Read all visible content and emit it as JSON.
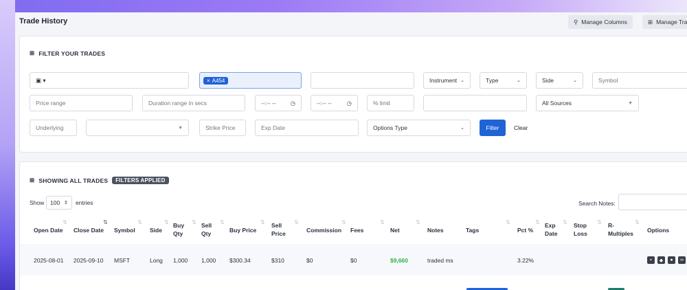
{
  "header": {
    "title": "Trade History",
    "manage_columns_label": "Manage Columns",
    "manage_tags_label": "Manage Tra"
  },
  "filters": {
    "title": "FILTER YOUR TRADES",
    "date_range_value": "▾",
    "account_tag": "A454",
    "instrument_label": "Instrument",
    "type_label": "Type",
    "side_label": "Side",
    "symbol_placeholder": "Symbol",
    "price_range_placeholder": "Price range",
    "duration_placeholder": "Duration range in secs",
    "time_from_value": "--:-- --",
    "time_to_value": "--:-- --",
    "pct_limit_placeholder": "% limit",
    "sources_label": "All Sources",
    "underlying_placeholder": "Underlying",
    "strike_placeholder": "Strike Price",
    "exp_date_placeholder": "Exp Date",
    "options_type_label": "Options Type",
    "filter_button": "Filter",
    "clear_button": "Clear"
  },
  "trades": {
    "title": "SHOWING ALL TRADES",
    "filters_badge": "FILTERS APPLIED",
    "show_label": "Show",
    "page_size": "100",
    "entries_label": "entries",
    "search_notes_label": "Search Notes:",
    "columns": [
      "Open Date",
      "Close Date",
      "Symbol",
      "Side",
      "Buy Qty",
      "Sell Qty",
      "Buy Price",
      "Sell Price",
      "Commission",
      "Fees",
      "Net",
      "Notes",
      "Tags",
      "Pct %",
      "Exp Date",
      "Stop Loss",
      "R-Multiples",
      "Options"
    ],
    "row1": {
      "open_date": "2025-08-01",
      "close_date": "2025-09-10",
      "symbol": "MSFT",
      "side": "Long",
      "buy_qty": "1,000",
      "sell_qty": "1,000",
      "buy_price": "$300.34",
      "sell_price": "$310",
      "commission": "$0",
      "fees": "$0",
      "net": "$9,660",
      "notes": "traded ms",
      "pct": "3.22%"
    }
  },
  "colors": {
    "primary": "#1f63d6",
    "positive": "#2fb44a",
    "dark_badge": "#4b5260"
  }
}
